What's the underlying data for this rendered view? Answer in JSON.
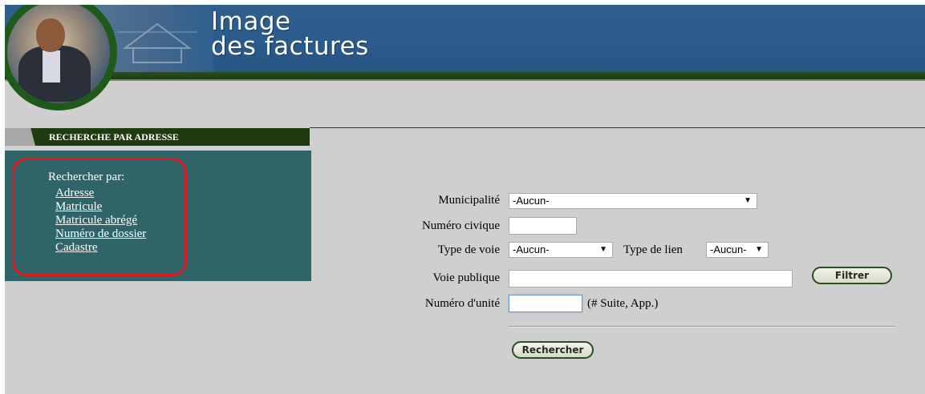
{
  "header": {
    "title_line1": "Image",
    "title_line2": "des factures"
  },
  "section": {
    "title": "RECHERCHE PAR ADRESSE"
  },
  "sidebar": {
    "title": "Rechercher par:",
    "links": [
      "Adresse",
      "Matricule",
      "Matricule abrégé",
      "Numéro de dossier",
      "Cadastre"
    ]
  },
  "form": {
    "municipalite": {
      "label": "Municipalité",
      "value": "-Aucun-"
    },
    "numero_civique": {
      "label": "Numéro civique",
      "value": ""
    },
    "type_voie": {
      "label": "Type de voie",
      "value": "-Aucun-"
    },
    "type_lien": {
      "label": "Type de lien",
      "value": "-Aucun-"
    },
    "voie_publique": {
      "label": "Voie publique",
      "value": ""
    },
    "numero_unite": {
      "label": "Numéro d'unité",
      "value": "",
      "hint": "(# Suite, App.)"
    },
    "filtrer_label": "Filtrer",
    "rechercher_label": "Rechercher"
  },
  "colors": {
    "banner_blue": "#2e5f8e",
    "dark_green": "#1e3c10",
    "sidebar_teal": "#2f6568",
    "highlight_red": "#e0171c",
    "page_grey": "#cfcfcf"
  }
}
